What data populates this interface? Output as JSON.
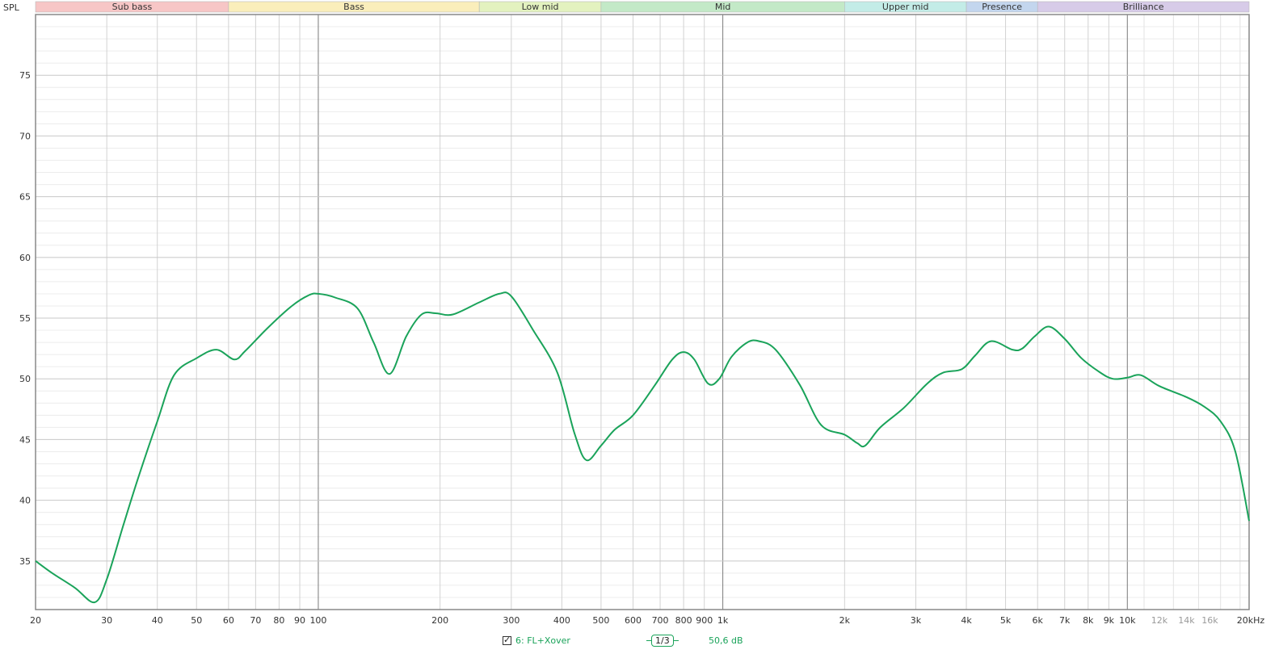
{
  "chart_data": {
    "type": "line",
    "ylabel": "SPL",
    "x_unit": "kHz",
    "x_scale": "log",
    "xlim": [
      20,
      20000
    ],
    "ylim": [
      31,
      80
    ],
    "y_ticks": [
      35,
      40,
      45,
      50,
      55,
      60,
      65,
      70,
      75
    ],
    "x_tick_labels": [
      {
        "v": 20,
        "t": "20"
      },
      {
        "v": 30,
        "t": "30"
      },
      {
        "v": 40,
        "t": "40"
      },
      {
        "v": 50,
        "t": "50"
      },
      {
        "v": 60,
        "t": "60"
      },
      {
        "v": 70,
        "t": "70"
      },
      {
        "v": 80,
        "t": "80"
      },
      {
        "v": 90,
        "t": "90"
      },
      {
        "v": 100,
        "t": "100"
      },
      {
        "v": 200,
        "t": "200"
      },
      {
        "v": 300,
        "t": "300"
      },
      {
        "v": 400,
        "t": "400"
      },
      {
        "v": 500,
        "t": "500"
      },
      {
        "v": 600,
        "t": "600"
      },
      {
        "v": 700,
        "t": "700"
      },
      {
        "v": 800,
        "t": "800"
      },
      {
        "v": 900,
        "t": "900"
      },
      {
        "v": 1000,
        "t": "1k"
      },
      {
        "v": 2000,
        "t": "2k"
      },
      {
        "v": 3000,
        "t": "3k"
      },
      {
        "v": 4000,
        "t": "4k"
      },
      {
        "v": 5000,
        "t": "5k"
      },
      {
        "v": 6000,
        "t": "6k"
      },
      {
        "v": 7000,
        "t": "7k"
      },
      {
        "v": 8000,
        "t": "8k"
      },
      {
        "v": 9000,
        "t": "9k"
      },
      {
        "v": 10000,
        "t": "10k"
      },
      {
        "v": 12000,
        "t": "12k"
      },
      {
        "v": 14000,
        "t": "14k"
      },
      {
        "v": 16000,
        "t": "16k"
      },
      {
        "v": 20000,
        "t": "20kHz"
      }
    ],
    "bands": [
      {
        "name": "Sub bass",
        "from": 20,
        "to": 60,
        "color": "#f7c6c6"
      },
      {
        "name": "Bass",
        "from": 60,
        "to": 250,
        "color": "#faeebb"
      },
      {
        "name": "Low mid",
        "from": 250,
        "to": 500,
        "color": "#e3f2bf"
      },
      {
        "name": "Mid",
        "from": 500,
        "to": 2000,
        "color": "#c3e9c7"
      },
      {
        "name": "Upper mid",
        "from": 2000,
        "to": 4000,
        "color": "#c3ece7"
      },
      {
        "name": "Presence",
        "from": 4000,
        "to": 6000,
        "color": "#c3d6ee"
      },
      {
        "name": "Brilliance",
        "from": 6000,
        "to": 20000,
        "color": "#d7cbe8"
      }
    ],
    "series": [
      {
        "name": "6: FL+Xover",
        "color": "#1aa35a",
        "points": [
          [
            20,
            35.0
          ],
          [
            22,
            34.0
          ],
          [
            25,
            32.8
          ],
          [
            28,
            31.6
          ],
          [
            30,
            33.5
          ],
          [
            33,
            38.0
          ],
          [
            36,
            42.0
          ],
          [
            40,
            46.5
          ],
          [
            44,
            50.3
          ],
          [
            50,
            51.7
          ],
          [
            56,
            52.4
          ],
          [
            62,
            51.6
          ],
          [
            66,
            52.3
          ],
          [
            75,
            54.2
          ],
          [
            86,
            56.0
          ],
          [
            95,
            56.9
          ],
          [
            100,
            57.0
          ],
          [
            110,
            56.7
          ],
          [
            125,
            55.8
          ],
          [
            137,
            53.0
          ],
          [
            150,
            50.4
          ],
          [
            165,
            53.5
          ],
          [
            180,
            55.3
          ],
          [
            195,
            55.4
          ],
          [
            215,
            55.3
          ],
          [
            250,
            56.3
          ],
          [
            280,
            57.0
          ],
          [
            300,
            56.8
          ],
          [
            340,
            54.0
          ],
          [
            390,
            50.5
          ],
          [
            430,
            45.5
          ],
          [
            460,
            43.3
          ],
          [
            500,
            44.5
          ],
          [
            540,
            45.8
          ],
          [
            600,
            47.0
          ],
          [
            680,
            49.5
          ],
          [
            750,
            51.6
          ],
          [
            800,
            52.2
          ],
          [
            850,
            51.6
          ],
          [
            920,
            49.6
          ],
          [
            980,
            50.0
          ],
          [
            1050,
            51.8
          ],
          [
            1150,
            53.0
          ],
          [
            1230,
            53.1
          ],
          [
            1350,
            52.4
          ],
          [
            1550,
            49.5
          ],
          [
            1750,
            46.2
          ],
          [
            2000,
            45.4
          ],
          [
            2150,
            44.7
          ],
          [
            2250,
            44.5
          ],
          [
            2450,
            46.0
          ],
          [
            2800,
            47.6
          ],
          [
            3200,
            49.6
          ],
          [
            3500,
            50.5
          ],
          [
            3900,
            50.8
          ],
          [
            4200,
            51.9
          ],
          [
            4600,
            53.1
          ],
          [
            5200,
            52.4
          ],
          [
            5500,
            52.5
          ],
          [
            5900,
            53.5
          ],
          [
            6400,
            54.3
          ],
          [
            7000,
            53.3
          ],
          [
            7700,
            51.7
          ],
          [
            8500,
            50.6
          ],
          [
            9200,
            50.0
          ],
          [
            10000,
            50.1
          ],
          [
            10800,
            50.3
          ],
          [
            12000,
            49.4
          ],
          [
            14000,
            48.5
          ],
          [
            15500,
            47.7
          ],
          [
            17000,
            46.5
          ],
          [
            18500,
            44.0
          ],
          [
            20000,
            38.3
          ]
        ]
      }
    ]
  },
  "legend": {
    "checkbox_label": "6: FL+Xover",
    "smoothing_label": "1/3",
    "level_readout": "50,6 dB"
  }
}
